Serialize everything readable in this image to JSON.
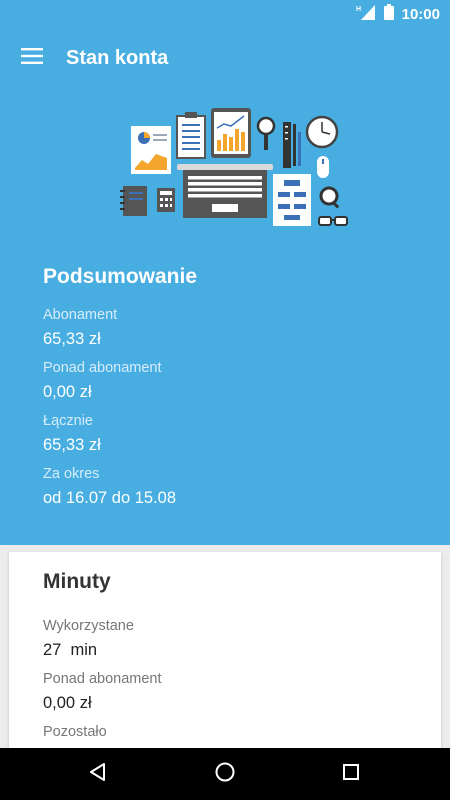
{
  "status_bar": {
    "time": "10:00",
    "network_type": "H",
    "icons": [
      "signal-icon",
      "battery-icon"
    ]
  },
  "app_bar": {
    "title": "Stan konta",
    "menu_icon": "hamburger-menu-icon"
  },
  "summary": {
    "title": "Podsumowanie",
    "fields": [
      {
        "label": "Abonament",
        "value": "65,33 zł"
      },
      {
        "label": "Ponad abonament",
        "value": "0,00 zł"
      },
      {
        "label": "Łącznie",
        "value": "65,33 zł"
      },
      {
        "label": "Za okres",
        "value": "od 16.07 do 15.08"
      }
    ]
  },
  "minutes": {
    "title": "Minuty",
    "fields": [
      {
        "label": "Wykorzystane",
        "value": "27  min"
      },
      {
        "label": "Ponad abonament",
        "value": "0,00 zł"
      },
      {
        "label": "Pozostało",
        "value": ""
      }
    ]
  },
  "nav": {
    "icons": [
      "back-icon",
      "home-icon",
      "recents-icon"
    ]
  },
  "colors": {
    "primary": "#48aee2",
    "card_background": "#ffffff",
    "page_background": "#ececec",
    "nav_bar": "#000000"
  }
}
